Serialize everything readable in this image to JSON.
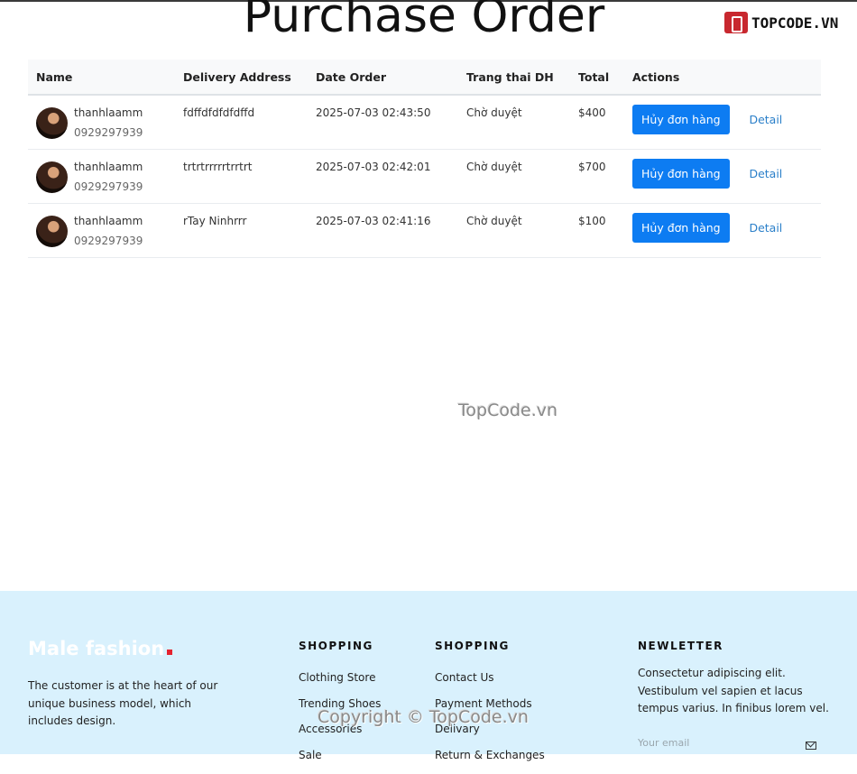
{
  "page": {
    "title": "Purchase Order"
  },
  "brand": {
    "text": "TOPCODE.VN",
    "accent": "#c8282f"
  },
  "table": {
    "headers": [
      "Name",
      "Delivery Address",
      "Date Order",
      "Trang thai DH",
      "Total",
      "Actions"
    ],
    "rows": [
      {
        "name": "thanhlaamm",
        "phone": "0929297939",
        "address": "fdffdfdfdfdffd",
        "date": "2025-07-03 02:43:50",
        "status": "Chờ duyệt",
        "total": "$400",
        "cancel": "Hủy đơn hàng",
        "detail": "Detail"
      },
      {
        "name": "thanhlaamm",
        "phone": "0929297939",
        "address": "trtrtrrrrrtrrtrt",
        "date": "2025-07-03 02:42:01",
        "status": "Chờ duyệt",
        "total": "$700",
        "cancel": "Hủy đơn hàng",
        "detail": "Detail"
      },
      {
        "name": "thanhlaamm",
        "phone": "0929297939",
        "address": "rTay Ninhrrr",
        "date": "2025-07-03 02:41:16",
        "status": "Chờ duyệt",
        "total": "$100",
        "cancel": "Hủy đơn hàng",
        "detail": "Detail"
      }
    ]
  },
  "watermarks": {
    "center": "TopCode.vn",
    "footer": "Copyright © TopCode.vn"
  },
  "footer": {
    "logo": "Male fashion",
    "about": "The customer is at the heart of our unique business model, which includes design.",
    "col1": {
      "title": "SHOPPING",
      "items": [
        "Clothing Store",
        "Trending Shoes",
        "Accessories",
        "Sale"
      ]
    },
    "col2": {
      "title": "SHOPPING",
      "items": [
        "Contact Us",
        "Payment Methods",
        "Delivary",
        "Return & Exchanges"
      ]
    },
    "newsletter": {
      "title": "NEWLETTER",
      "text": "Consectetur adipiscing elit. Vestibulum vel sapien et lacus tempus varius. In finibus lorem vel.",
      "placeholder": "Your email"
    }
  },
  "colors": {
    "primary": "#0d7cf2",
    "link": "#2a7fc9",
    "footer_bg": "#d9f1fd"
  }
}
